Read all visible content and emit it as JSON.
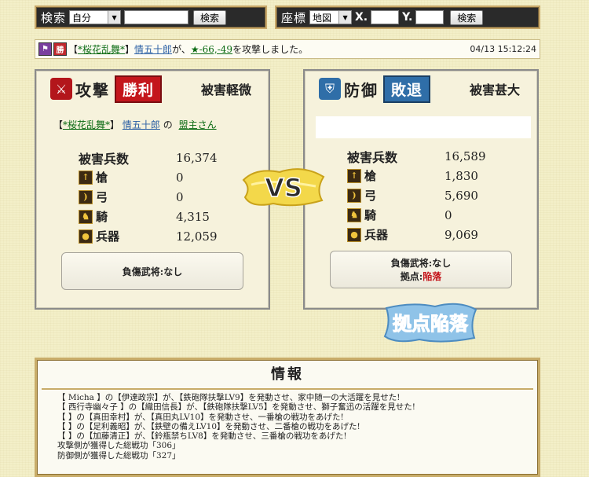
{
  "search": {
    "label": "検索",
    "select_value": "自分",
    "input_value": "",
    "button": "検索"
  },
  "coords": {
    "label": "座標",
    "select_value": "地図",
    "x_label": "X.",
    "y_label": "Y.",
    "x_value": "",
    "y_value": "",
    "button": "検索"
  },
  "notice": {
    "icon1": "flag-icon",
    "badge": "勝",
    "open_bracket": "【",
    "alliance": "*桜花乱舞*",
    "close_bracket": "】",
    "player": "情五十郎",
    "middle_text": "が、",
    "coordinate": "★-66,-49",
    "end_text": "を攻撃しました。",
    "time": "04/13 15:12:24"
  },
  "attack": {
    "title": "攻撃",
    "result": "勝利",
    "damage_level": "被害軽微",
    "open_bracket": "【",
    "alliance": "*桜花乱舞*",
    "close_bracket": "】",
    "player": "情五十郎",
    "possessive": "の",
    "general": "盟主さん",
    "stats": [
      {
        "label": "被害兵数",
        "value": "16,374",
        "icon": ""
      },
      {
        "label": "槍",
        "value": "0",
        "icon": "spear-icon"
      },
      {
        "label": "弓",
        "value": "0",
        "icon": "bow-icon"
      },
      {
        "label": "騎",
        "value": "4,315",
        "icon": "horse-icon"
      },
      {
        "label": "兵器",
        "value": "12,059",
        "icon": "siege-weapon-icon"
      }
    ],
    "injured": "負傷武将:なし"
  },
  "defense": {
    "title": "防御",
    "result": "敗退",
    "damage_level": "被害甚大",
    "stats": [
      {
        "label": "被害兵数",
        "value": "16,589",
        "icon": ""
      },
      {
        "label": "槍",
        "value": "1,830",
        "icon": "spear-icon"
      },
      {
        "label": "弓",
        "value": "5,690",
        "icon": "bow-icon"
      },
      {
        "label": "騎",
        "value": "0",
        "icon": "horse-icon"
      },
      {
        "label": "兵器",
        "value": "9,069",
        "icon": "siege-weapon-icon"
      }
    ],
    "injured": "負傷武将:なし",
    "base_label": "拠点:",
    "base_status": "陥落"
  },
  "vs_text": "VS",
  "stamp_text": "拠点陥落",
  "info": {
    "title": "情報",
    "lines": [
      "【 Micha 】の【伊達政宗】が、【鉄砲隊扶撃LV9】を発動させ、家中随一の大活躍を見せた!",
      "【 西行寺幽々子 】の【織田信長】が、【鉄砲隊扶撃LV5】を発動させ、獅子奮迅の活躍を見せた!",
      "【 】の【真田幸村】が、【真田丸LV10】を発動させ、一番槍の戦功をあげた!",
      "【 】の【足利義昭】が、【鉄壁の備えLV10】を発動させ、二番槍の戦功をあげた!",
      "【 】の【加藤清正】が、【鈴瓶禁ちLV8】を発動させ、三番槍の戦功をあげた!",
      "攻撃側が獲得した総戦功「306」",
      "防御側が獲得した総戦功「327」"
    ]
  },
  "colors": {
    "victory_badge": "#c4161c",
    "defeat_badge": "#2f6ea8",
    "fallen_text": "#c4161c",
    "link_green": "#0a6a12"
  }
}
